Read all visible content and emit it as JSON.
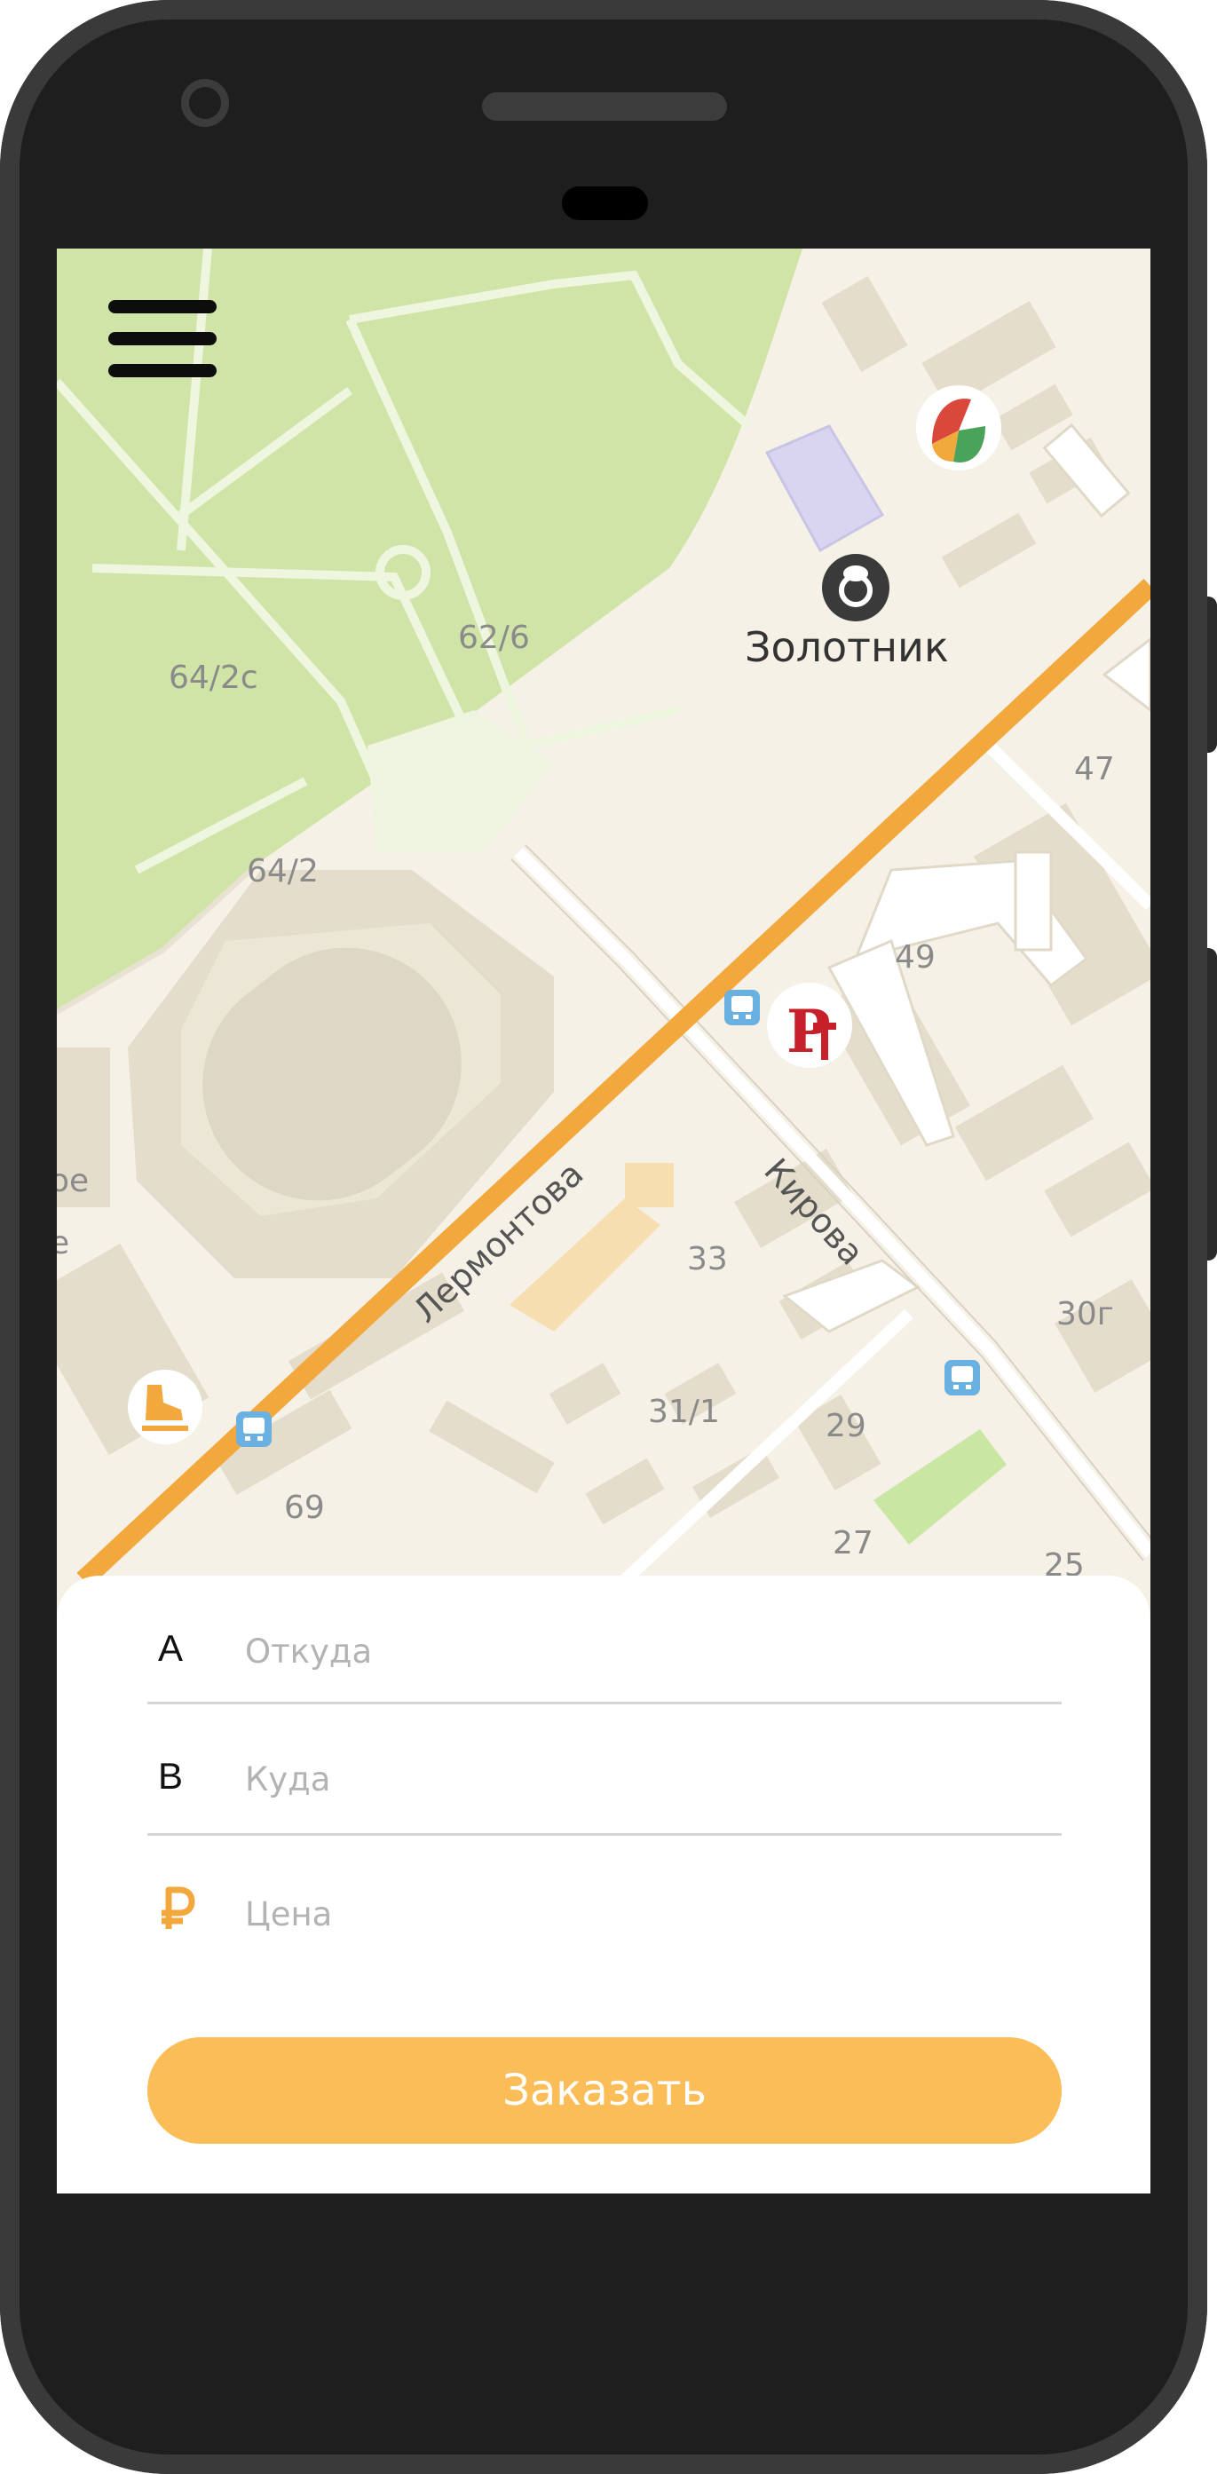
{
  "map": {
    "streets": [
      "Лермонтова",
      "Кирова"
    ],
    "poi": {
      "jeweler_label": "Золотник"
    },
    "house_numbers": [
      "64/2с",
      "62/6",
      "64/2",
      "47",
      "49",
      "33",
      "31/1",
      "29",
      "30г",
      "69",
      "27",
      "25"
    ]
  },
  "order_form": {
    "from": {
      "letter": "A",
      "placeholder": "Откуда",
      "value": ""
    },
    "to": {
      "letter": "B",
      "placeholder": "Куда",
      "value": ""
    },
    "price": {
      "icon": "ruble-icon",
      "placeholder": "Цена",
      "value": ""
    },
    "submit_label": "Заказать"
  },
  "icons": {
    "menu": "hamburger-menu-icon",
    "bus_stop": "bus-stop-icon",
    "skating": "ice-skate-icon",
    "jeweler": "ring-icon"
  },
  "colors": {
    "accent": "#fbbd58",
    "main_road": "#f2a83c",
    "park": "#cfe4a6",
    "map_base": "#f5f1e6",
    "bus_stop": "#6ab0e0"
  }
}
